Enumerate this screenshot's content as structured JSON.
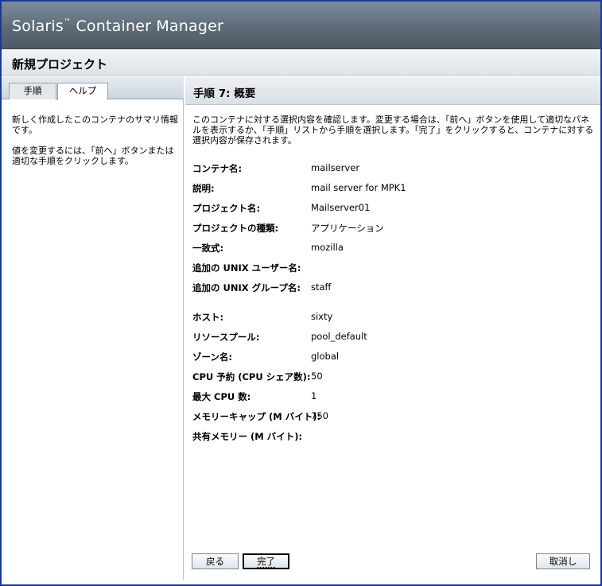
{
  "app": {
    "title_prefix": "Solaris",
    "title_tm": "™",
    "title_suffix": " Container Manager"
  },
  "wizard": {
    "title": "新規プロジェクト"
  },
  "left_pane": {
    "tabs": [
      {
        "label": "手順",
        "selected": false
      },
      {
        "label": "ヘルプ",
        "selected": true
      }
    ],
    "help_paragraphs": [
      "新しく作成したこのコンテナのサマリ情報です。",
      "値を変更するには、「前へ」ボタンまたは適切な手順をクリックします。"
    ]
  },
  "step": {
    "title": "手順 7:  概要",
    "instructions": "このコンテナに対する選択内容を確認します。変更する場合は、「前へ」ボタンを使用して適切なパネルを表示するか、「手順」リストから手順を選択します。「完了」をクリックすると、コンテナに対する選択内容が保存されます。"
  },
  "summary": {
    "rows": [
      {
        "label": "コンテナ名:",
        "value": "mailserver"
      },
      {
        "label": "説明:",
        "value": "mail server for MPK1"
      },
      {
        "label": "プロジェクト名:",
        "value": "Mailserver01"
      },
      {
        "label": "プロジェクトの種類:",
        "value": "アプリケーション"
      },
      {
        "label": "一致式:",
        "value": "mozilla"
      },
      {
        "label": "追加の UNIX ユーザー名:",
        "value": ""
      },
      {
        "label": "追加の UNIX グループ名:",
        "value": "staff"
      },
      {
        "label": "ホスト:",
        "value": "sixty"
      },
      {
        "label": "リソースプール:",
        "value": "pool_default"
      },
      {
        "label": "ゾーン名:",
        "value": "global"
      },
      {
        "label": "CPU 予約 (CPU シェア数):",
        "value": "50"
      },
      {
        "label": "最大 CPU 数:",
        "value": "1"
      },
      {
        "label": "メモリーキャップ (M バイト):",
        "value": "750"
      },
      {
        "label": "共有メモリー (M バイト):",
        "value": ""
      }
    ]
  },
  "buttons": {
    "back": "戻る",
    "finish": "完了",
    "cancel": "取消し"
  }
}
